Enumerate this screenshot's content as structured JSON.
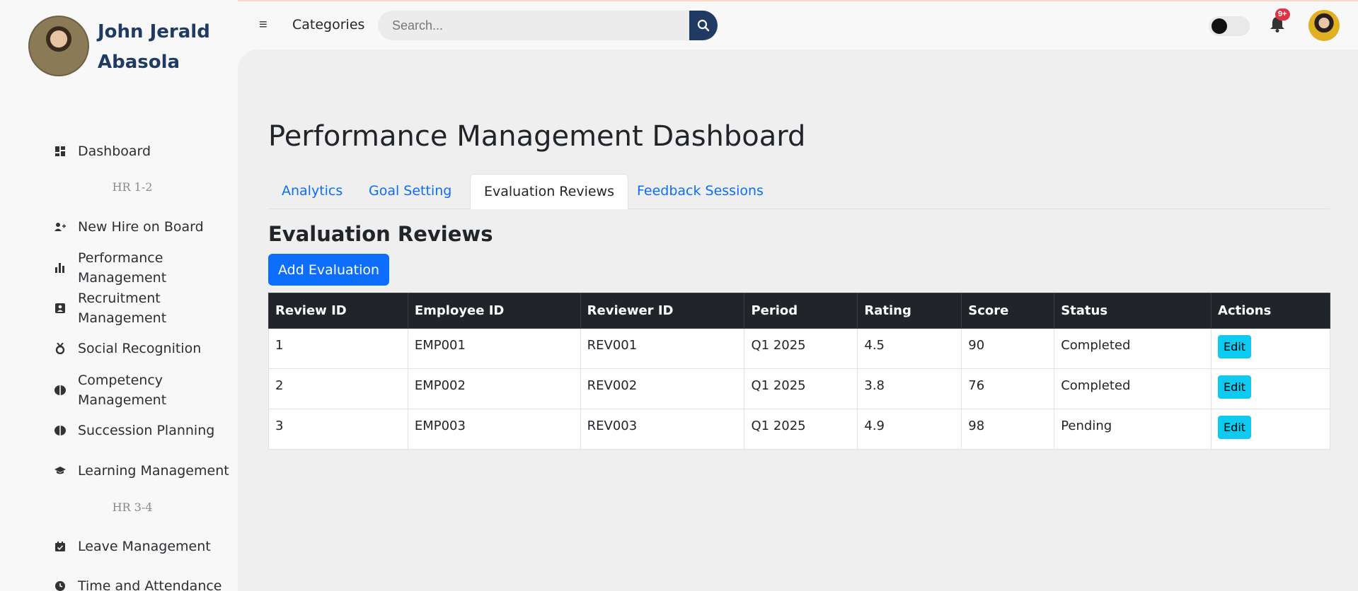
{
  "user": {
    "name": "John Jerald Abasola"
  },
  "sidebar": {
    "items": [
      {
        "label": "Dashboard",
        "icon": "dashboard-icon"
      },
      {
        "label": "New Hire on Board",
        "icon": "user-plus-icon"
      },
      {
        "label": "Performance Management",
        "icon": "bar-chart-icon"
      },
      {
        "label": "Recruitment Management",
        "icon": "id-badge-icon"
      },
      {
        "label": "Social Recognition",
        "icon": "medal-icon"
      },
      {
        "label": "Competency Management",
        "icon": "brain-icon"
      },
      {
        "label": "Succession Planning",
        "icon": "brain-icon"
      },
      {
        "label": "Learning Management",
        "icon": "graduation-cap-icon"
      },
      {
        "label": "Leave Management",
        "icon": "calendar-check-icon"
      },
      {
        "label": "Time and Attendance",
        "icon": "clock-icon"
      }
    ],
    "sections": [
      "HR 1-2",
      "HR 3-4"
    ]
  },
  "topbar": {
    "categories_label": "Categories",
    "search_placeholder": "Search...",
    "notification_badge": "9+"
  },
  "main": {
    "page_title": "Performance Management Dashboard",
    "tabs": [
      {
        "label": "Analytics",
        "active": false
      },
      {
        "label": "Goal Setting",
        "active": false
      },
      {
        "label": "Evaluation Reviews",
        "active": true
      },
      {
        "label": "Feedback Sessions",
        "active": false
      }
    ],
    "section_title": "Evaluation Reviews",
    "add_button": "Add Evaluation",
    "table": {
      "headers": [
        "Review ID",
        "Employee ID",
        "Reviewer ID",
        "Period",
        "Rating",
        "Score",
        "Status",
        "Actions"
      ],
      "rows": [
        [
          "1",
          "EMP001",
          "REV001",
          "Q1 2025",
          "4.5",
          "90",
          "Completed",
          "Edit"
        ],
        [
          "2",
          "EMP002",
          "REV002",
          "Q1 2025",
          "3.8",
          "76",
          "Completed",
          "Edit"
        ],
        [
          "3",
          "EMP003",
          "REV003",
          "Q1 2025",
          "4.9",
          "98",
          "Pending",
          "Edit"
        ]
      ]
    }
  },
  "colors": {
    "brand": "#1f3b63",
    "primary": "#0d6efd",
    "info": "#0dcaf0",
    "table_header": "#212529",
    "danger": "#dc3545"
  }
}
